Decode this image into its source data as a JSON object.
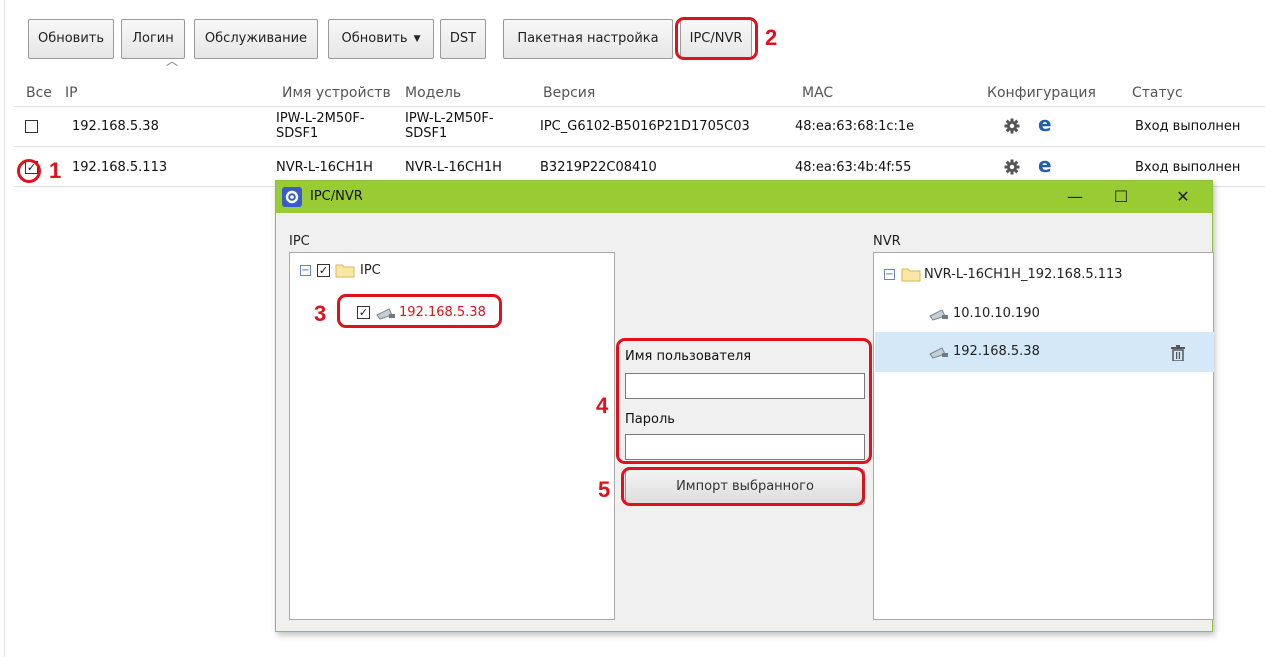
{
  "toolbar": {
    "buttons": [
      "Обновить",
      "Логин",
      "Обслуживание",
      "Обновить",
      "DST",
      "Пакетная настройка",
      "IPC/NVR"
    ]
  },
  "table": {
    "headers": {
      "select_all": "Все",
      "ip": "IP",
      "device_name": "Имя устройств",
      "model": "Модель",
      "version": "Версия",
      "mac": "MAC",
      "config": "Конфигурация",
      "status": "Статус"
    },
    "rows": [
      {
        "checked": false,
        "ip": "192.168.5.38",
        "device_name_1": "IPW-L-2M50F-",
        "device_name_2": "SDSF1",
        "model_1": "IPW-L-2M50F-",
        "model_2": "SDSF1",
        "version": "IPC_G6102-B5016P21D1705C03",
        "mac": "48:ea:63:68:1c:1e",
        "status": "Вход выполнен"
      },
      {
        "checked": true,
        "ip": "192.168.5.113",
        "device_name": "NVR-L-16CH1H",
        "model": "NVR-L-16CH1H",
        "version": "B3219P22C08410",
        "mac": "48:ea:63:4b:4f:55",
        "status": "Вход выполнен"
      }
    ]
  },
  "dialog": {
    "title": "IPC/NVR",
    "ipc_label": "IPC",
    "nvr_label": "NVR",
    "ipc_tree": {
      "root": "IPC",
      "child": "192.168.5.38"
    },
    "nvr_tree": {
      "root": "NVR-L-16CH1H_192.168.5.113",
      "children": [
        "10.10.10.190",
        "192.168.5.38"
      ]
    },
    "form": {
      "username_label": "Имя пользователя",
      "username_value": "",
      "password_label": "Пароль",
      "password_value": "",
      "import_button": "Импорт выбранного"
    }
  },
  "annotations": [
    "1",
    "2",
    "3",
    "4",
    "5"
  ],
  "colors": {
    "annotation": "#e0101c",
    "titlebar": "#99cc33",
    "selected_row": "#d4e8f7",
    "ie_icon": "#1f5fae"
  }
}
